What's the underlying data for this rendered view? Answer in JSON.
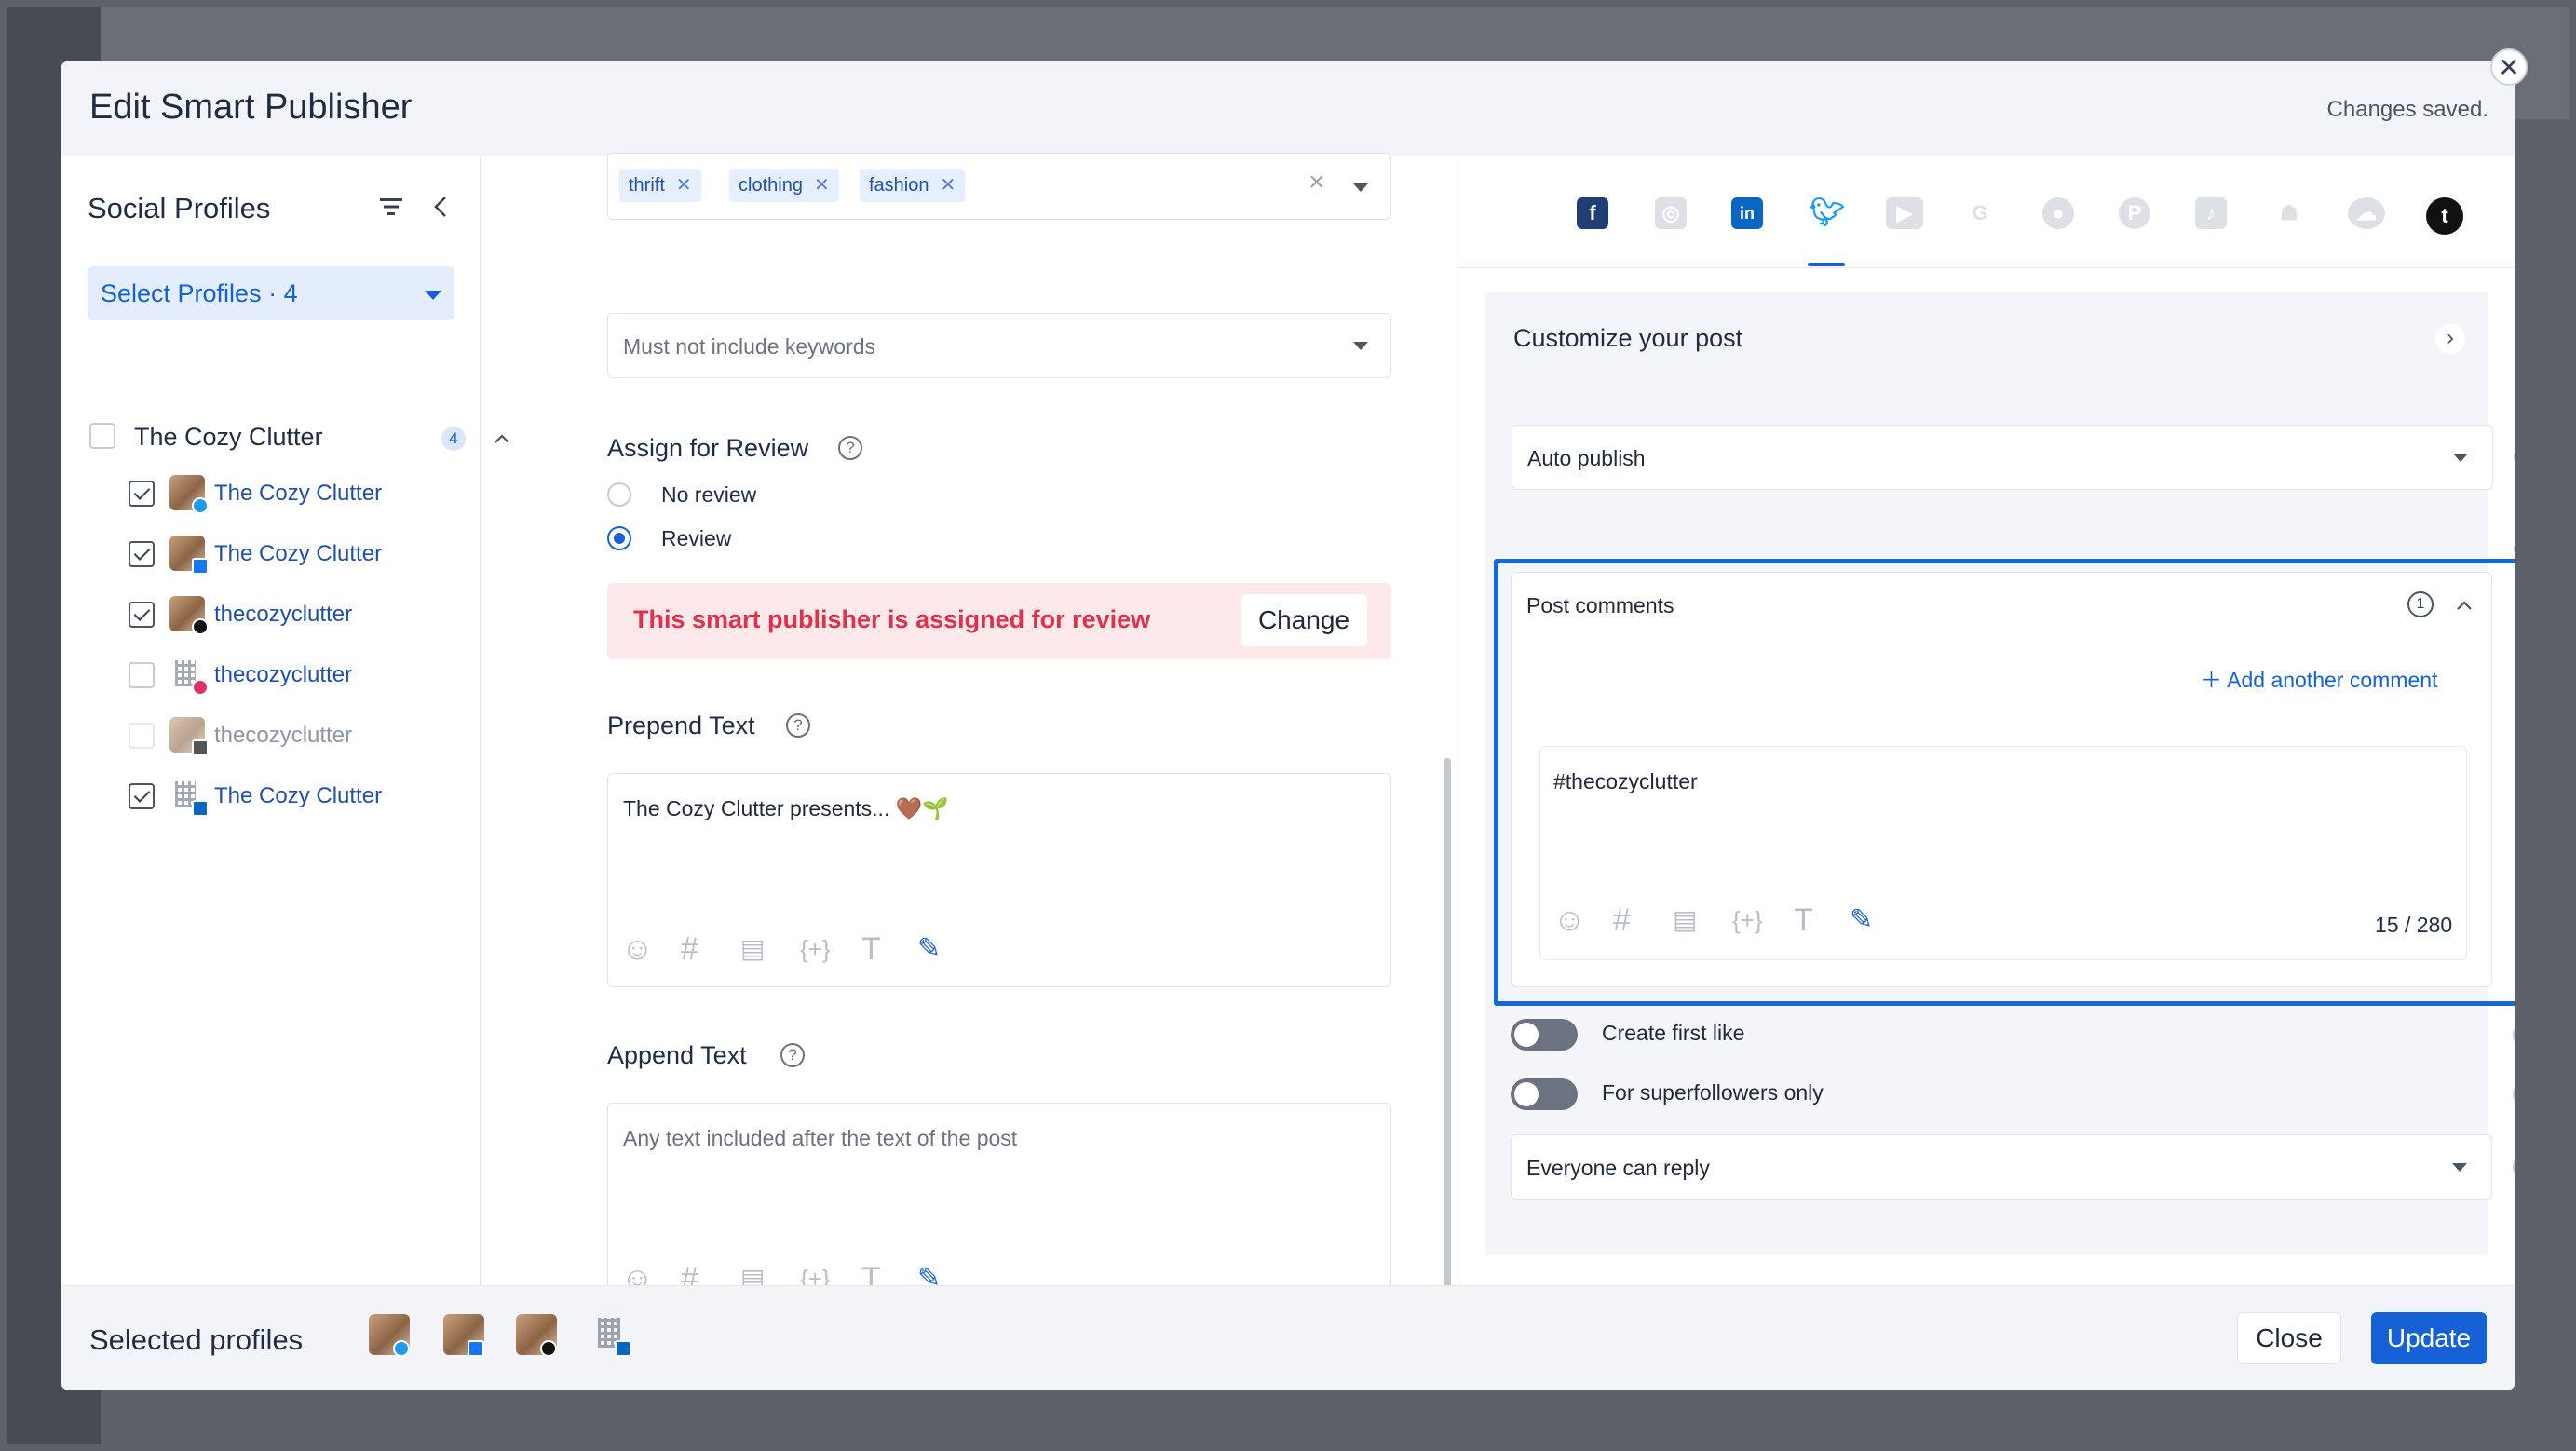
{
  "modal": {
    "title": "Edit Smart Publisher",
    "status": "Changes saved.",
    "close_glyph": "✕"
  },
  "sidebar": {
    "title": "Social Profiles",
    "select_label": "Select Profiles · 4",
    "group": {
      "name": "The Cozy Clutter",
      "count": "4",
      "checked": false
    },
    "profiles": [
      {
        "name": "The Cozy Clutter",
        "network": "twitter",
        "checked": true,
        "disabled": false
      },
      {
        "name": "The Cozy Clutter",
        "network": "facebook",
        "checked": true,
        "disabled": false
      },
      {
        "name": "thecozyclutter",
        "network": "tumblr",
        "checked": true,
        "disabled": false
      },
      {
        "name": "thecozyclutter",
        "network": "instagram",
        "checked": false,
        "disabled": false
      },
      {
        "name": "thecozyclutter",
        "network": "tiktok",
        "checked": false,
        "disabled": true
      },
      {
        "name": "The Cozy Clutter",
        "network": "linkedin",
        "checked": true,
        "disabled": false
      }
    ]
  },
  "middle": {
    "include_tags": [
      "thrift",
      "clothing",
      "fashion"
    ],
    "exclude_placeholder": "Must not include keywords",
    "assign_review": {
      "label": "Assign for Review",
      "options": [
        "No review",
        "Review"
      ],
      "selected": "Review",
      "notice": "This smart publisher is assigned for review",
      "change_label": "Change"
    },
    "prepend": {
      "label": "Prepend Text",
      "value": "The Cozy Clutter presents... 🤎🌱"
    },
    "append": {
      "label": "Append Text",
      "placeholder": "Any text included after the text of the post"
    },
    "toolbar_icons": [
      "emoji-icon",
      "hashtag-icon",
      "snippet-icon",
      "variable-icon",
      "text-format-icon",
      "magic-wand-icon"
    ]
  },
  "right": {
    "network_tabs": [
      "facebook",
      "instagram",
      "linkedin",
      "twitter",
      "youtube",
      "google",
      "reddit",
      "pinterest",
      "tiktok",
      "snapchat",
      "bluesky",
      "tumblr"
    ],
    "active_tab": "twitter",
    "customize_title": "Customize your post",
    "publish_mode": "Auto publish",
    "post_comments": {
      "title": "Post comments",
      "count": "1",
      "add_label": "Add another comment",
      "comment": "#thecozyclutter",
      "char_count": "15 / 280"
    },
    "toggles": [
      {
        "label": "Create first like",
        "on": false
      },
      {
        "label": "For superfollowers only",
        "on": false
      }
    ],
    "reply_setting": "Everyone can reply"
  },
  "footer": {
    "selected_label": "Selected profiles",
    "selected_networks": [
      "twitter",
      "facebook",
      "tumblr",
      "linkedin"
    ],
    "close_label": "Close",
    "update_label": "Update"
  },
  "colors": {
    "accent": "#1560d4",
    "highlight_border": "#1468d8",
    "review_notice_bg": "#fde8ea",
    "review_notice_text": "#e0304b"
  }
}
